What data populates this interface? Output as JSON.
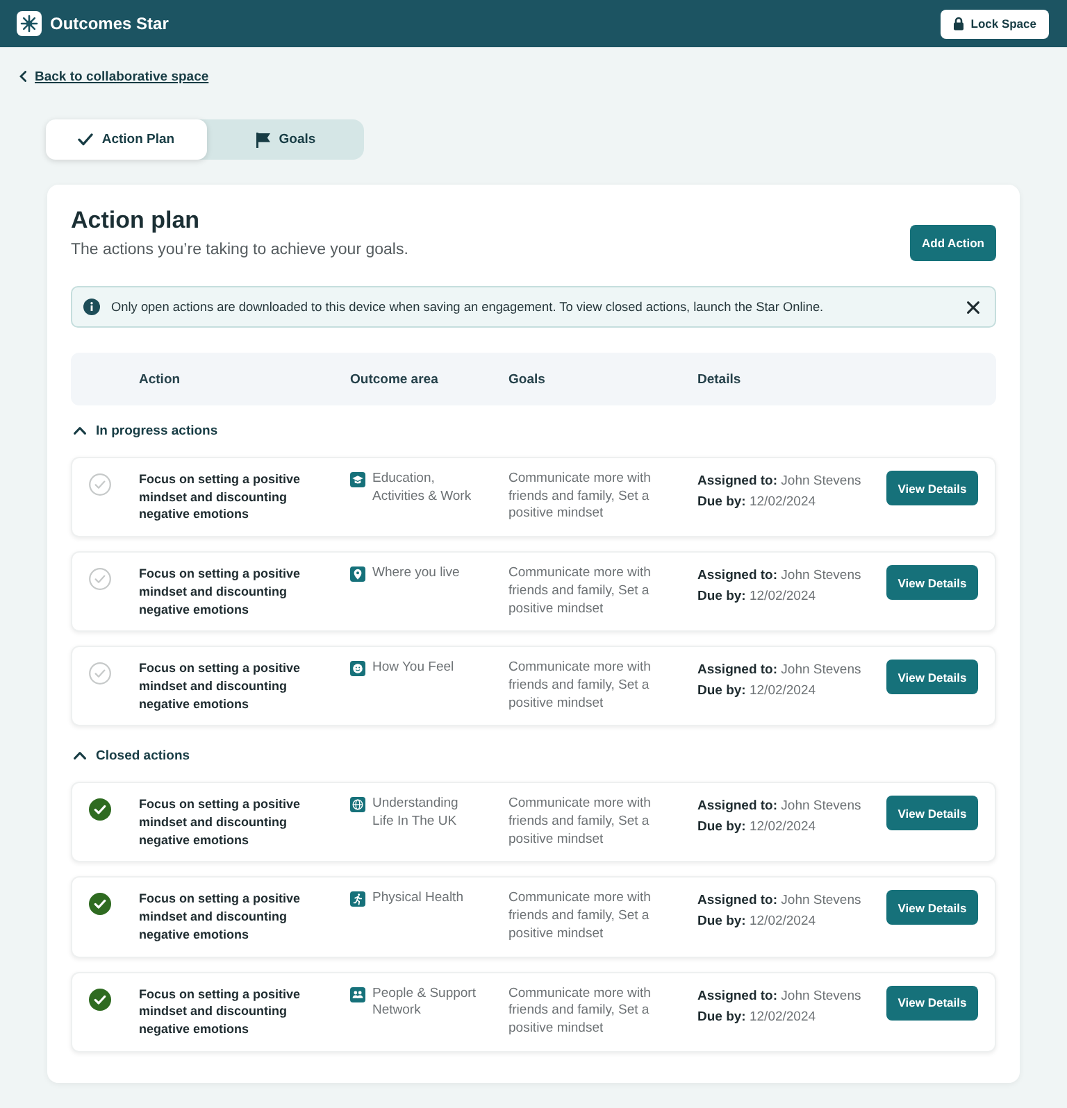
{
  "header": {
    "app_name": "Outcomes Star",
    "lock_button": "Lock Space"
  },
  "back_link": "Back to collaborative space",
  "tabs": [
    {
      "label": "Action Plan",
      "kind": "check",
      "selected": true
    },
    {
      "label": "Goals",
      "kind": "flag",
      "selected": false
    }
  ],
  "plan": {
    "title": "Action plan",
    "subtitle": "The actions you’re taking to achieve your goals.",
    "add_button": "Add Action"
  },
  "notice": {
    "text": "Only open actions are downloaded to this device when saving an engagement. To view closed actions, launch the Star Online."
  },
  "table": {
    "columns": [
      "Action",
      "Outcome area",
      "Goals",
      "Details"
    ],
    "sections": [
      {
        "title": "In progress actions",
        "expanded": true,
        "rows": [
          {
            "completed": false,
            "action": "Focus on setting a positive mindset and discounting negative emotions",
            "outcome_area": {
              "kind": "education",
              "label": "Education, Activities & Work"
            },
            "goals": "Communicate more with friends and family, Set a positive mindset",
            "assigned": "**Assigned to:** John Stevens",
            "due": "**Due by:** 12/02/2024",
            "button": "View Details"
          },
          {
            "completed": false,
            "action": "Focus on setting a positive mindset and discounting negative emotions",
            "outcome_area": {
              "kind": "location",
              "label": "Where you live"
            },
            "goals": "Communicate more with friends and family, Set a positive mindset",
            "assigned": "**Assigned to:** John Stevens",
            "due": "**Due by:** 12/02/2024",
            "button": "View Details"
          },
          {
            "completed": false,
            "action": "Focus on setting a positive mindset and discounting negative emotions",
            "outcome_area": {
              "kind": "feelings",
              "label": "How You Feel"
            },
            "goals": "Communicate more with friends and family, Set a positive mindset",
            "assigned": "**Assigned to:** John Stevens",
            "due": "**Due by:** 12/02/2024",
            "button": "View Details"
          }
        ]
      },
      {
        "title": "Closed actions",
        "expanded": true,
        "rows": [
          {
            "completed": true,
            "action": "Focus on setting a positive mindset and discounting negative emotions",
            "outcome_area": {
              "kind": "globe",
              "label": "Understanding Life In The UK"
            },
            "goals": "Communicate more with friends and family, Set a positive mindset",
            "assigned": "**Assigned to:** John Stevens",
            "due": "**Due by:** 12/02/2024",
            "button": "View Details"
          },
          {
            "completed": true,
            "action": "Focus on setting a positive mindset and discounting negative emotions",
            "outcome_area": {
              "kind": "health",
              "label": "Physical Health"
            },
            "goals": "Communicate more with friends and family, Set a positive mindset",
            "assigned": "**Assigned to:** John Stevens",
            "due": "**Due by:** 12/02/2024",
            "button": "View Details"
          },
          {
            "completed": true,
            "action": "Focus on setting a positive mindset and discounting negative emotions",
            "outcome_area": {
              "kind": "people",
              "label": "People & Support Network"
            },
            "goals": "Communicate more with friends and family, Set a positive mindset",
            "assigned": "**Assigned to:** John Stevens",
            "due": "**Due by:** 12/02/2024",
            "button": "View Details"
          }
        ]
      }
    ]
  }
}
